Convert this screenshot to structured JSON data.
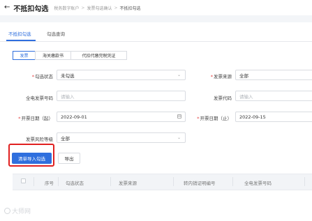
{
  "header": {
    "back_icon": "←",
    "title": "不抵扣勾选",
    "breadcrumb": [
      "税务数字账户",
      "发票勾选确认",
      "不抵扣勾选"
    ],
    "separator": ">"
  },
  "tabs": [
    "不抵扣勾选",
    "勾选查询"
  ],
  "segments": [
    "发票",
    "海关缴款书",
    "代扣代缴完税凭证"
  ],
  "form": {
    "select_status_label": "勾选状态",
    "select_status_value": "未勾选",
    "invoice_source_label": "发票来源",
    "invoice_source_value": "全部",
    "full_invoice_no_label": "全电发票号码",
    "full_invoice_no_placeholder": "请输入",
    "invoice_code_label": "发票代码",
    "invoice_code_placeholder": "请输入",
    "date_start_label": "开票日期（起）",
    "date_start_value": "2022-09-01",
    "date_end_label": "开票日期（止）",
    "date_end_value": "2022-09-15",
    "risk_level_label": "发票风险等级",
    "risk_level_value": "全部"
  },
  "actions": {
    "import_label": "清单导入勾选",
    "export_label": "导出"
  },
  "table": {
    "headers": [
      "序号",
      "勾选状态",
      "发票来源",
      "转内销证明编号",
      "全电发票号码"
    ]
  },
  "watermark": "大师网"
}
